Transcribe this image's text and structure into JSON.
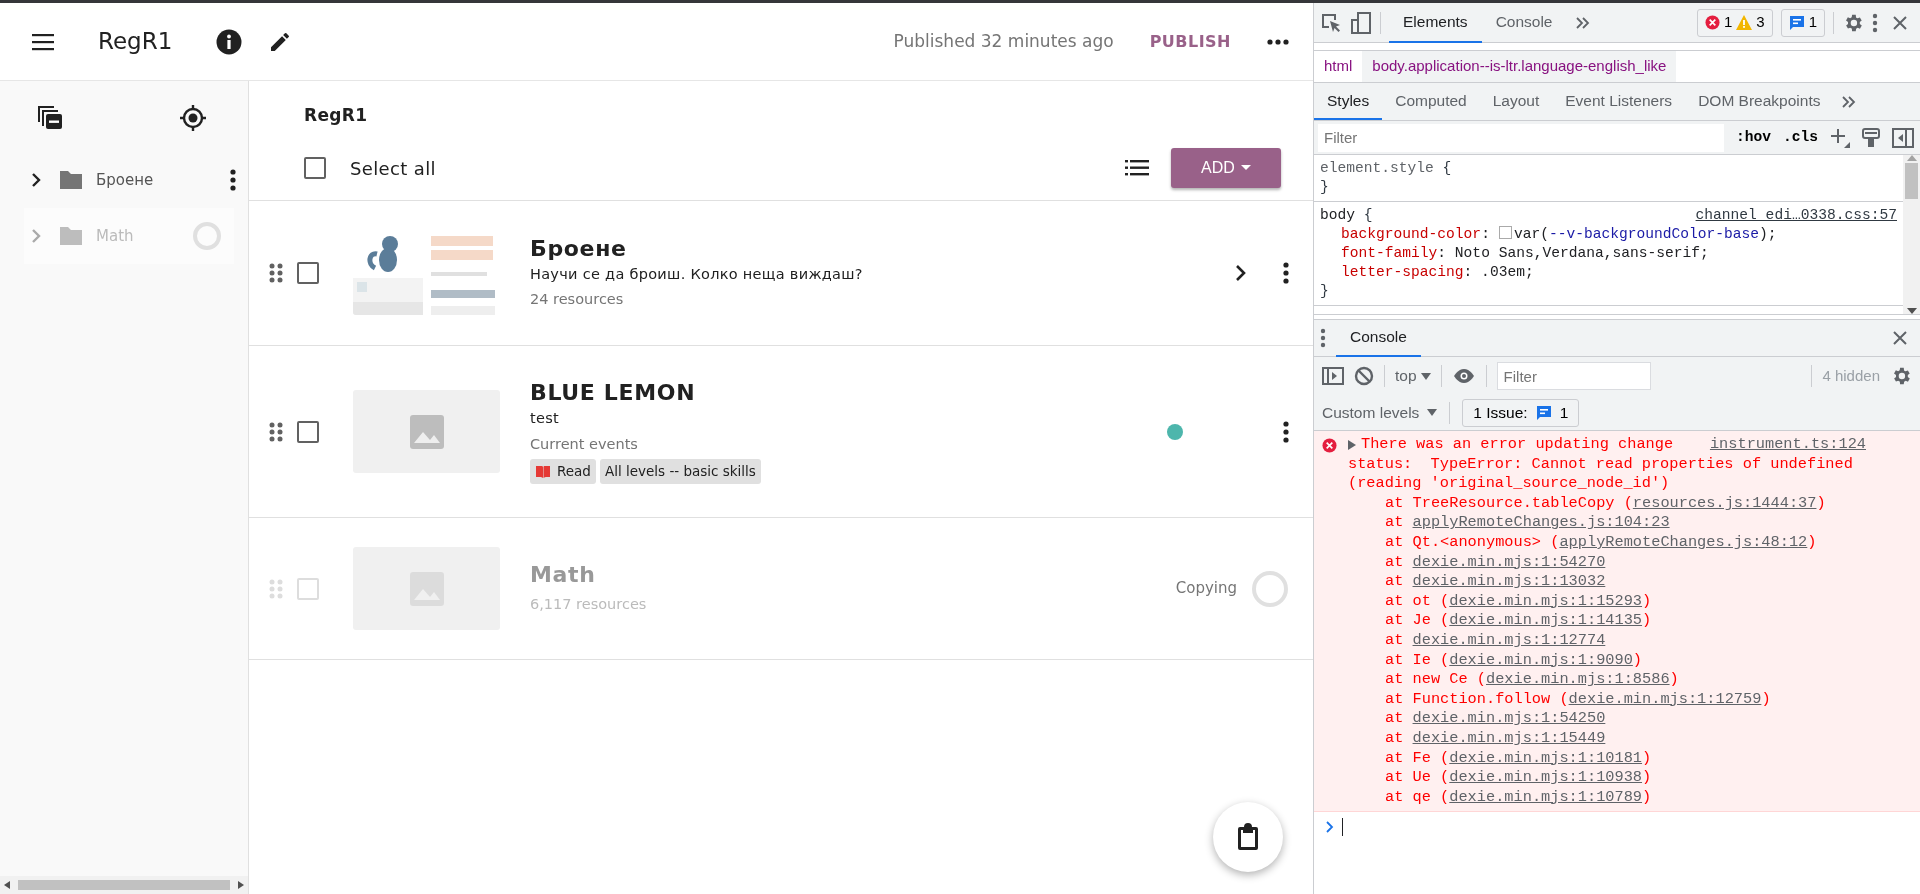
{
  "app_bar": {
    "title": "RegR1",
    "publish_status": "Published 32 minutes ago",
    "publish_button": "PUBLISH"
  },
  "sidebar": {
    "items": [
      {
        "label": "Броене",
        "disabled": false
      },
      {
        "label": "Math",
        "disabled": true
      }
    ]
  },
  "content": {
    "title": "RegR1",
    "select_all": {
      "label": "Select all",
      "checked": false
    },
    "add_button": "ADD",
    "rows": [
      {
        "kind": "topic",
        "title": "Броене",
        "description": "Научи се да броиш. Колко неща виждаш?",
        "subtitle": "24 resources",
        "checked": false,
        "disabled": false,
        "changed": false
      },
      {
        "kind": "resource",
        "thumbnail": {
          "kind": "placeholder"
        },
        "title": "BLUE LEMON",
        "description": "test",
        "subtitle": "Current events",
        "checked": false,
        "disabled": false,
        "changed": true,
        "tags": [
          {
            "label": "Read",
            "kind": "activity"
          },
          {
            "label": "All levels -- basic skills",
            "kind": "level"
          }
        ]
      },
      {
        "kind": "copying",
        "thumbnail": {
          "kind": "placeholder"
        },
        "title": "Math",
        "subtitle": "6,117 resources",
        "status": "Copying",
        "checked": false,
        "disabled": true,
        "changed": false
      }
    ]
  },
  "devtools": {
    "tabs": [
      {
        "label": "Elements",
        "selected": true
      },
      {
        "label": "Console",
        "selected": false
      }
    ],
    "error_count": "1",
    "warning_count": "3",
    "issue_count": "1",
    "breadcrumb": [
      {
        "label": "html",
        "selected": false
      },
      {
        "label": "body.application--is-ltr.language-english_like",
        "selected": true
      }
    ],
    "styles_tabs": [
      {
        "label": "Styles",
        "selected": true
      },
      {
        "label": "Computed",
        "selected": false
      },
      {
        "label": "Layout",
        "selected": false
      },
      {
        "label": "Event Listeners",
        "selected": false
      },
      {
        "label": "DOM Breakpoints",
        "selected": false
      }
    ],
    "styles_filter": {
      "placeholder": "Filter"
    },
    "hov": ":hov",
    "cls": ".cls",
    "rules": [
      {
        "selector": "element.style",
        "open": "{",
        "close": "}"
      },
      {
        "selector": "body",
        "open": "{",
        "close": "}",
        "source": "channel_edi…0338.css:57",
        "declarations": [
          [
            {
              "kind": "property",
              "text": "background-color"
            },
            {
              "kind": "plain",
              "text": ":"
            },
            {
              "kind": "swatch"
            },
            {
              "kind": "plain",
              "text": "var("
            },
            {
              "kind": "var",
              "text": "--v-backgroundColor-base"
            },
            {
              "kind": "plain",
              "text": ");"
            }
          ],
          [
            {
              "kind": "property",
              "text": "font-family"
            },
            {
              "kind": "plain",
              "text": ": Noto Sans,Verdana,sans-serif;"
            }
          ],
          [
            {
              "kind": "property",
              "text": "letter-spacing"
            },
            {
              "kind": "plain",
              "text": ": .03em;"
            }
          ]
        ]
      }
    ],
    "console": {
      "tab": "Console",
      "context": "top",
      "filter": {
        "placeholder": "Filter"
      },
      "hidden": "4 hidden",
      "levels": "Custom levels",
      "issues_label": "1 Issue:",
      "issues_count": "1",
      "error": {
        "lines": [
          "There was an error updating change",
          "status:  TypeError: Cannot read properties of undefined",
          "(reading 'original_source_node_id')"
        ],
        "source": "instrument.ts:124",
        "frames": [
          {
            "text": "at TreeResource.tableCopy (",
            "link": "resources.js:1444:37",
            "tail": ")"
          },
          {
            "text": "at ",
            "link": "applyRemoteChanges.js:104:23"
          },
          {
            "text": "at Qt.<anonymous> (",
            "link": "applyRemoteChanges.js:48:12",
            "tail": ")"
          },
          {
            "text": "at ",
            "link": "dexie.min.mjs:1:54270"
          },
          {
            "text": "at ",
            "link": "dexie.min.mjs:1:13032"
          },
          {
            "text": "at ot (",
            "link": "dexie.min.mjs:1:15293",
            "tail": ")"
          },
          {
            "text": "at Je (",
            "link": "dexie.min.mjs:1:14135",
            "tail": ")"
          },
          {
            "text": "at ",
            "link": "dexie.min.mjs:1:12774"
          },
          {
            "text": "at Ie (",
            "link": "dexie.min.mjs:1:9090",
            "tail": ")"
          },
          {
            "text": "at new Ce (",
            "link": "dexie.min.mjs:1:8586",
            "tail": ")"
          },
          {
            "text": "at Function.follow (",
            "link": "dexie.min.mjs:1:12759",
            "tail": ")"
          },
          {
            "text": "at ",
            "link": "dexie.min.mjs:1:54250"
          },
          {
            "text": "at ",
            "link": "dexie.min.mjs:1:15449"
          },
          {
            "text": "at Fe (",
            "link": "dexie.min.mjs:1:10181",
            "tail": ")"
          },
          {
            "text": "at Ue (",
            "link": "dexie.min.mjs:1:10938",
            "tail": ")"
          },
          {
            "text": "at qe (",
            "link": "dexie.min.mjs:1:10789",
            "tail": ")"
          }
        ]
      }
    }
  }
}
